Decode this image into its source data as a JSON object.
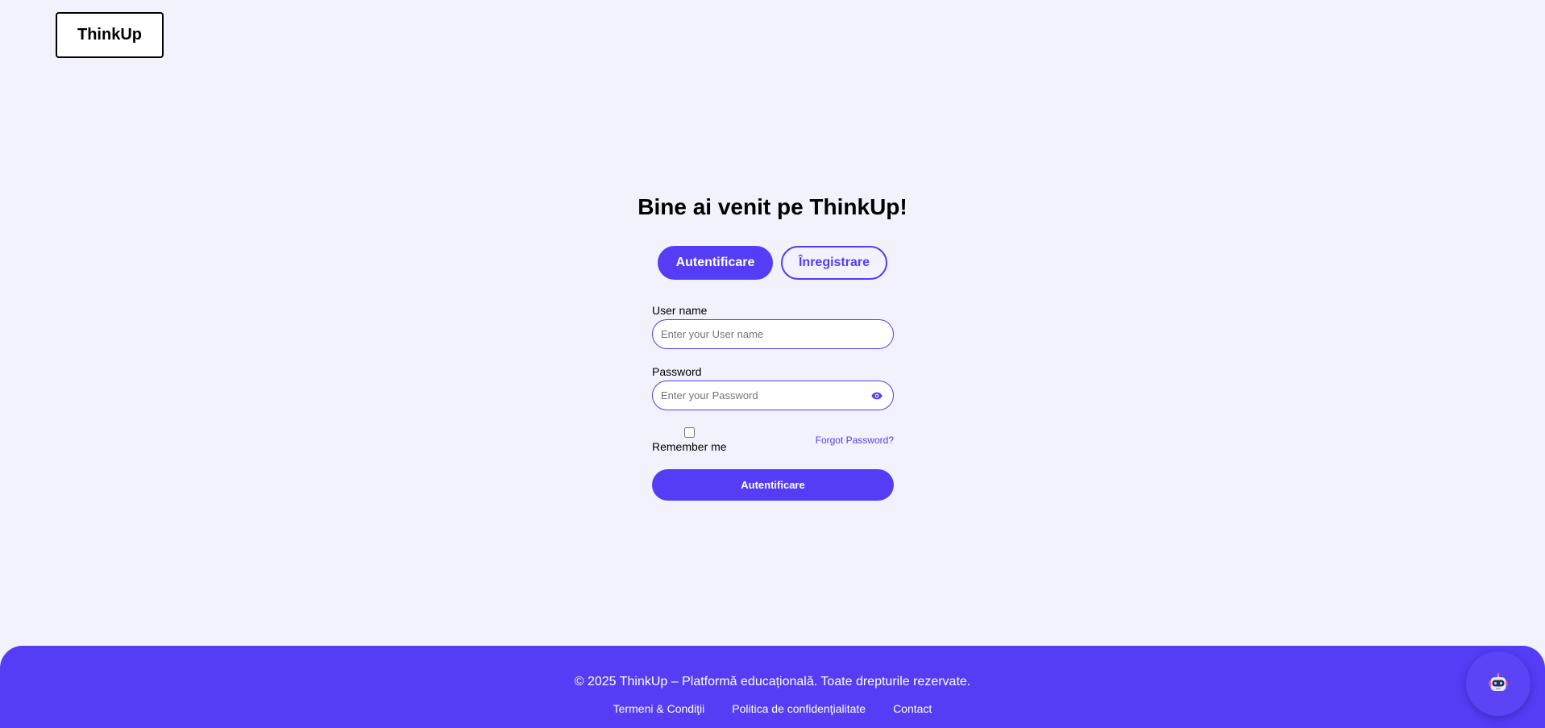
{
  "header": {
    "logo": "ThinkUp"
  },
  "auth": {
    "title": "Bine ai venit pe ThinkUp!",
    "tabs": [
      {
        "label": "Autentificare",
        "active": true
      },
      {
        "label": "Înregistrare",
        "active": false
      }
    ],
    "username": {
      "label": "User name",
      "placeholder": "Enter your User name",
      "value": ""
    },
    "password": {
      "label": "Password",
      "placeholder": "Enter your Password",
      "value": "",
      "toggle_icon": "eye-icon"
    },
    "remember_me": {
      "label": "Remember me",
      "checked": false
    },
    "forgot_password": "Forgot Password?",
    "submit_label": "Autentificare"
  },
  "footer": {
    "copyright": "© 2025 ThinkUp – Platformă educațională. Toate drepturile rezervate.",
    "links": [
      "Termeni & Condiţii",
      "Politica de confidenţialitate",
      "Contact"
    ]
  },
  "chatbot": {
    "icon": "robot-icon"
  },
  "colors": {
    "accent": "#543df5",
    "background": "#f2f2fd"
  }
}
